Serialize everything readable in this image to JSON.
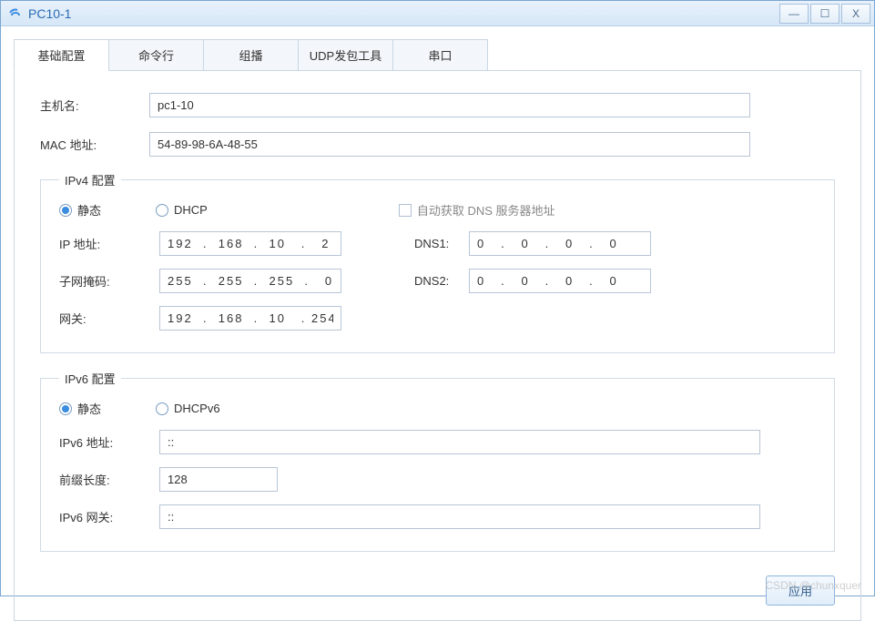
{
  "window": {
    "title": "PC10-1"
  },
  "tabs": [
    "基础配置",
    "命令行",
    "组播",
    "UDP发包工具",
    "串口"
  ],
  "basic": {
    "hostname_label": "主机名:",
    "hostname": "pc1-10",
    "mac_label": "MAC 地址:",
    "mac": "54-89-98-6A-48-55"
  },
  "ipv4": {
    "legend": "IPv4 配置",
    "static_label": "静态",
    "dhcp_label": "DHCP",
    "auto_dns_label": "自动获取 DNS 服务器地址",
    "ip_label": "IP 地址:",
    "ip": "192  .  168  .  10   .   2",
    "mask_label": "子网掩码:",
    "mask": "255  .  255  .  255  .   0",
    "gateway_label": "网关:",
    "gateway": "192  .  168  .  10   . 254",
    "dns1_label": "DNS1:",
    "dns1": "0   .   0   .   0   .   0",
    "dns2_label": "DNS2:",
    "dns2": "0   .   0   .   0   .   0"
  },
  "ipv6": {
    "legend": "IPv6 配置",
    "static_label": "静态",
    "dhcp_label": "DHCPv6",
    "ip_label": "IPv6 地址:",
    "ip": "::",
    "prefix_label": "前缀长度:",
    "prefix": "128",
    "gateway_label": "IPv6 网关:",
    "gateway": "::"
  },
  "footer": {
    "apply": "应用"
  },
  "watermark": "CSDN @chunxquer"
}
